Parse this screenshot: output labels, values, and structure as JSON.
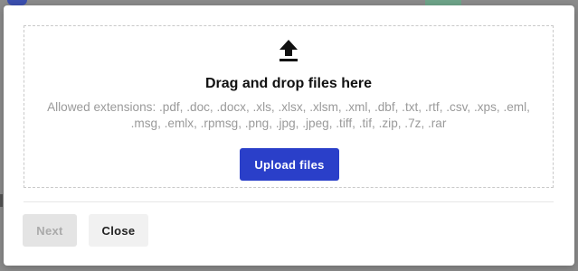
{
  "dialog": {
    "dropzone": {
      "icon": "upload-icon",
      "title": "Drag and drop files here",
      "allowed_extensions": "Allowed extensions: .pdf, .doc, .docx, .xls, .xlsx, .xlsm, .xml, .dbf, .txt, .rtf, .csv, .xps, .eml, .msg, .emlx, .rpmsg, .png, .jpg, .jpeg, .tiff, .tif, .zip, .7z, .rar",
      "upload_button_label": "Upload files"
    },
    "footer": {
      "next_label": "Next",
      "next_disabled": true,
      "close_label": "Close"
    }
  },
  "colors": {
    "primary": "#2a3fc9",
    "disabled_bg": "#e4e4e4",
    "muted_text": "#9a9a9a"
  }
}
